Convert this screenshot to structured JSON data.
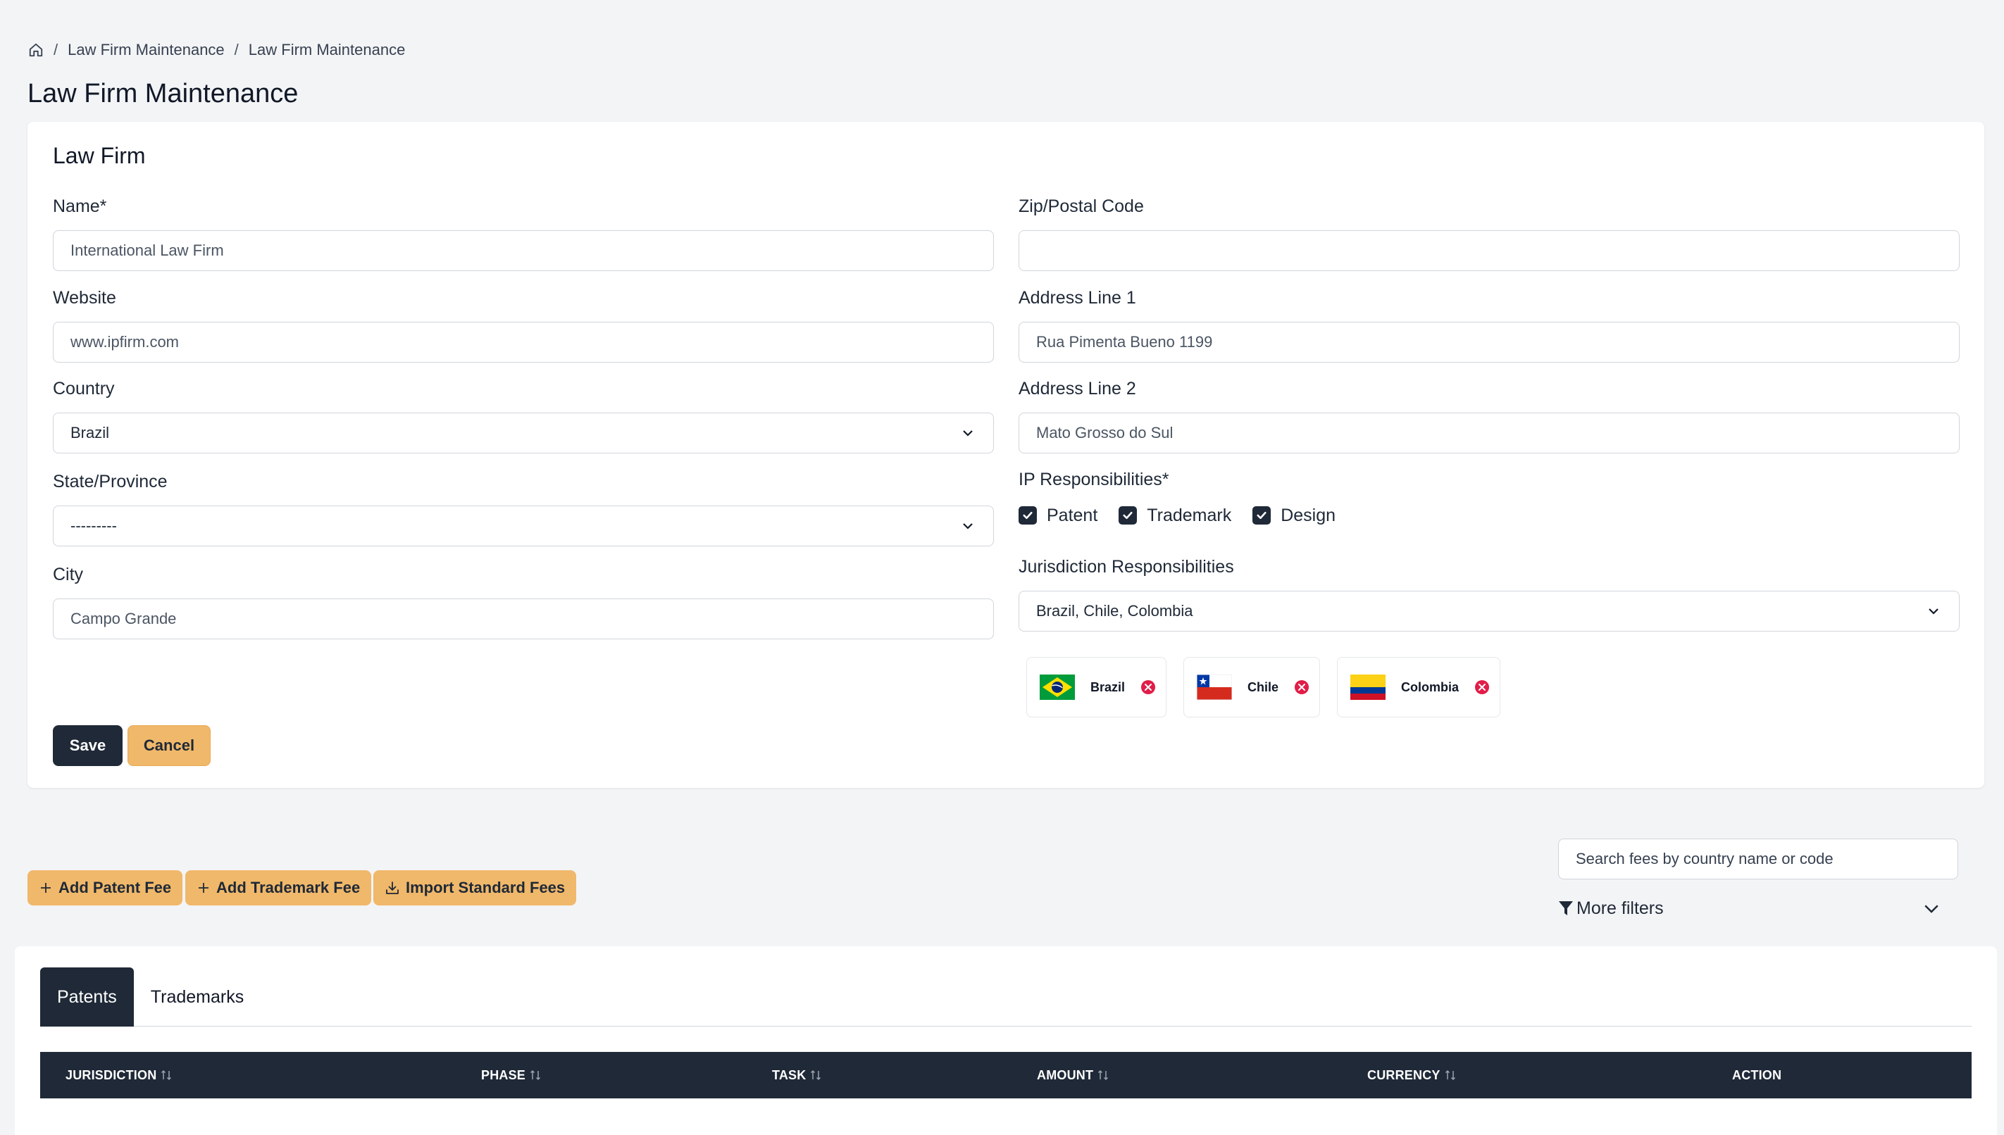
{
  "breadcrumb": {
    "items": [
      "Law Firm Maintenance",
      "Law Firm Maintenance"
    ]
  },
  "page_title": "Law Firm Maintenance",
  "form": {
    "card_title": "Law Firm",
    "name": {
      "label": "Name*",
      "value": "International Law Firm"
    },
    "website": {
      "label": "Website",
      "value": "www.ipfirm.com"
    },
    "country": {
      "label": "Country",
      "value": "Brazil"
    },
    "state": {
      "label": "State/Province",
      "value": "---------"
    },
    "city": {
      "label": "City",
      "value": "Campo Grande"
    },
    "zip": {
      "label": "Zip/Postal Code",
      "value": ""
    },
    "address1": {
      "label": "Address Line 1",
      "value": "Rua Pimenta Bueno 1199"
    },
    "address2": {
      "label": "Address Line 2",
      "value": "Mato Grosso do Sul"
    },
    "ip_responsibilities": {
      "label": "IP Responsibilities*",
      "options": [
        {
          "label": "Patent",
          "checked": true
        },
        {
          "label": "Trademark",
          "checked": true
        },
        {
          "label": "Design",
          "checked": true
        }
      ]
    },
    "jurisdiction": {
      "label": "Jurisdiction Responsibilities",
      "value": "Brazil, Chile, Colombia",
      "chips": [
        {
          "label": "Brazil",
          "flag": "brazil-flag-icon"
        },
        {
          "label": "Chile",
          "flag": "chile-flag-icon"
        },
        {
          "label": "Colombia",
          "flag": "colombia-flag-icon"
        }
      ]
    },
    "save_label": "Save",
    "cancel_label": "Cancel"
  },
  "fee_actions": {
    "add_patent": "Add Patent Fee",
    "add_trademark": "Add Trademark Fee",
    "import_standard": "Import Standard Fees",
    "search_placeholder": "Search fees by country name or code",
    "more_filters": "More filters"
  },
  "fees_panel": {
    "tabs": [
      {
        "label": "Patents",
        "active": true
      },
      {
        "label": "Trademarks",
        "active": false
      }
    ],
    "columns": [
      "JURISDICTION",
      "PHASE",
      "TASK",
      "AMOUNT",
      "CURRENCY",
      "ACTION"
    ]
  },
  "colors": {
    "primary_dark": "#1f2937",
    "accent_orange": "#f0b86a",
    "remove_red": "#e11d48",
    "background": "#f3f4f6"
  }
}
